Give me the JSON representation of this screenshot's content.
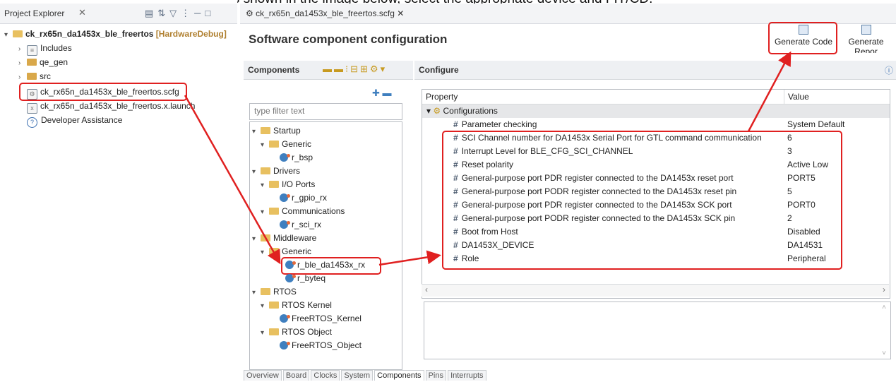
{
  "caption": "Open the Smart Configurator as shown in the image below, select the appropriate device and FIT/CD.",
  "project_explorer": {
    "tab_label": "Project Explorer",
    "tab_close": "✕",
    "tree": [
      {
        "label": "ck_rx65n_da1453x_ble_freertos",
        "suffix": " [HardwareDebug]"
      },
      {
        "label": "Includes"
      },
      {
        "label": "qe_gen"
      },
      {
        "label": "src"
      },
      {
        "label": "ck_rx65n_da1453x_ble_freertos.scfg"
      },
      {
        "label": "ck_rx65n_da1453x_ble_freertos.x.launch"
      },
      {
        "label": "Developer Assistance"
      }
    ]
  },
  "editor": {
    "tab_label": "ck_rx65n_da1453x_ble_freertos.scfg",
    "tab_close": "✕",
    "title": "Software component configuration",
    "generate_code": "Generate Code",
    "generate_report": "Generate Repor",
    "components_title": "Components",
    "configure_title": "Configure",
    "filter_placeholder": "type filter text",
    "tree": [
      {
        "label": "Startup"
      },
      {
        "label": "Generic"
      },
      {
        "label": "r_bsp"
      },
      {
        "label": "Drivers"
      },
      {
        "label": "I/O Ports"
      },
      {
        "label": "r_gpio_rx"
      },
      {
        "label": "Communications"
      },
      {
        "label": "r_sci_rx"
      },
      {
        "label": "Middleware"
      },
      {
        "label": "Generic"
      },
      {
        "label": "r_ble_da1453x_rx"
      },
      {
        "label": "r_byteq"
      },
      {
        "label": "RTOS"
      },
      {
        "label": "RTOS Kernel"
      },
      {
        "label": "FreeRTOS_Kernel"
      },
      {
        "label": "RTOS Object"
      },
      {
        "label": "FreeRTOS_Object"
      }
    ],
    "table": {
      "header_property": "Property",
      "header_value": "Value",
      "group": "Configurations",
      "rows": [
        {
          "name": "Parameter checking",
          "value": "System Default"
        },
        {
          "name": "SCI Channel number for DA1453x Serial Port for GTL command communication",
          "value": "6"
        },
        {
          "name": "Interrupt Level for BLE_CFG_SCI_CHANNEL",
          "value": "3"
        },
        {
          "name": "Reset polarity",
          "value": "Active Low"
        },
        {
          "name": "General-purpose port PDR register connected to the DA1453x reset port",
          "value": "PORT5"
        },
        {
          "name": "General-purpose port PODR register connected to the DA1453x reset pin",
          "value": "5"
        },
        {
          "name": "General-purpose port PDR register connected to the DA1453x SCK port",
          "value": "PORT0"
        },
        {
          "name": "General-purpose port PODR register connected to the DA1453x SCK pin",
          "value": "2"
        },
        {
          "name": "Boot from Host",
          "value": "Disabled"
        },
        {
          "name": "DA1453X_DEVICE",
          "value": "DA14531"
        },
        {
          "name": "Role",
          "value": "Peripheral"
        }
      ]
    },
    "bottom_tabs": [
      "Overview",
      "Board",
      "Clocks",
      "System",
      "Components",
      "Pins",
      "Interrupts"
    ],
    "active_bottom_tab": "Components"
  },
  "colors": {
    "highlight": "#e02020",
    "selection": "#d7d9dc"
  }
}
